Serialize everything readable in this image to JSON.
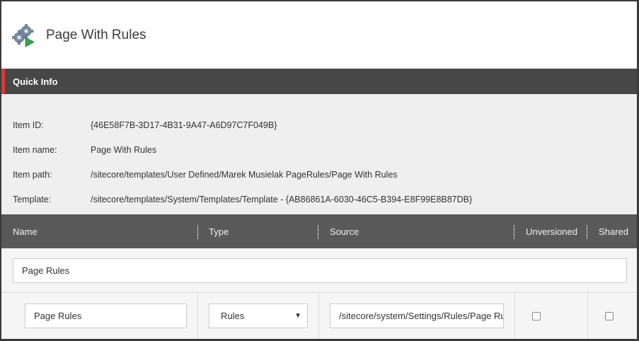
{
  "page": {
    "title": "Page With Rules",
    "icon": "gears-play-icon"
  },
  "quick_info": {
    "heading": "Quick Info",
    "rows": [
      {
        "label": "Item ID:",
        "value": "{46E58F7B-3D17-4B31-9A47-A6D97C7F049B}"
      },
      {
        "label": "Item name:",
        "value": "Page With Rules"
      },
      {
        "label": "Item path:",
        "value": "/sitecore/templates/User Defined/Marek Musielak PageRules/Page With Rules"
      },
      {
        "label": "Template:",
        "value": "/sitecore/templates/System/Templates/Template - {AB86861A-6030-46C5-B394-E8F99E8B87DB}"
      }
    ]
  },
  "grid": {
    "columns": {
      "name": "Name",
      "type": "Type",
      "source": "Source",
      "unversioned": "Unversioned",
      "shared": "Shared"
    },
    "section": {
      "name": "Page Rules"
    },
    "field": {
      "name": "Page Rules",
      "type": "Rules",
      "source": "/sitecore/system/Settings/Rules/Page Rules",
      "unversioned": false,
      "shared": false
    }
  },
  "colors": {
    "accent": "#d93a34",
    "header_dark": "#474747",
    "grid_header": "#595959"
  }
}
